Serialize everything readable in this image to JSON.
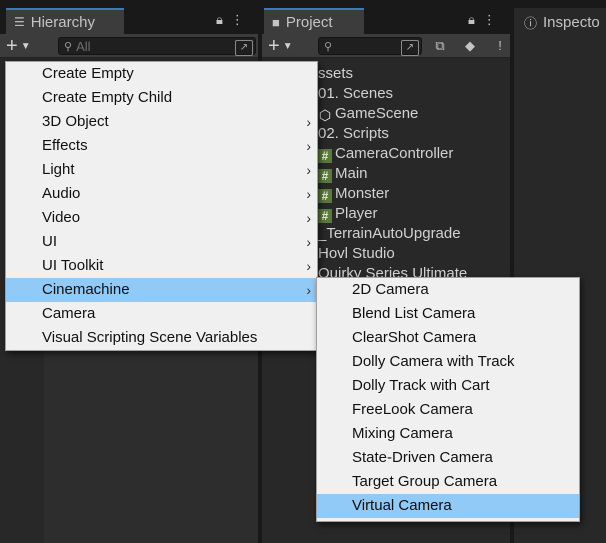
{
  "hierarchy": {
    "title": "Hierarchy",
    "search_placeholder": "All"
  },
  "project": {
    "title": "Project",
    "tree": [
      {
        "label": "ssets",
        "icon": "none"
      },
      {
        "label": "01. Scenes",
        "icon": "none"
      },
      {
        "label": "GameScene",
        "icon": "unity-scene-icon"
      },
      {
        "label": "02. Scripts",
        "icon": "none"
      },
      {
        "label": "CameraController",
        "icon": "csharp-script-icon"
      },
      {
        "label": "Main",
        "icon": "csharp-script-icon"
      },
      {
        "label": "Monster",
        "icon": "csharp-script-icon"
      },
      {
        "label": "Player",
        "icon": "csharp-script-icon"
      },
      {
        "label": "_TerrainAutoUpgrade",
        "icon": "none"
      },
      {
        "label": "Hovl Studio",
        "icon": "none"
      },
      {
        "label": "Quirky Series Ultimate",
        "icon": "none"
      }
    ]
  },
  "inspector": {
    "title": "Inspecto"
  },
  "context_menu": {
    "items": [
      {
        "label": "Create Empty",
        "submenu": false
      },
      {
        "label": "Create Empty Child",
        "submenu": false
      },
      {
        "label": "3D Object",
        "submenu": true
      },
      {
        "label": "Effects",
        "submenu": true
      },
      {
        "label": "Light",
        "submenu": true
      },
      {
        "label": "Audio",
        "submenu": true
      },
      {
        "label": "Video",
        "submenu": true
      },
      {
        "label": "UI",
        "submenu": true
      },
      {
        "label": "UI Toolkit",
        "submenu": true
      },
      {
        "label": "Cinemachine",
        "submenu": true,
        "highlighted": true
      },
      {
        "label": "Camera",
        "submenu": false
      },
      {
        "label": "Visual Scripting Scene Variables",
        "submenu": false
      }
    ]
  },
  "cinemachine_menu": {
    "items": [
      {
        "label": "2D Camera"
      },
      {
        "label": "Blend List Camera"
      },
      {
        "label": "ClearShot Camera"
      },
      {
        "label": "Dolly Camera with Track"
      },
      {
        "label": "Dolly Track with Cart"
      },
      {
        "label": "FreeLook Camera"
      },
      {
        "label": "Mixing Camera"
      },
      {
        "label": "State-Driven Camera"
      },
      {
        "label": "Target Group Camera"
      },
      {
        "label": "Virtual Camera",
        "highlighted": true
      }
    ]
  },
  "colors": {
    "highlight": "#91c9f7",
    "menu_bg": "#f0f0f0",
    "panel_bg": "#282828",
    "tab_accent": "#3a79bb"
  }
}
